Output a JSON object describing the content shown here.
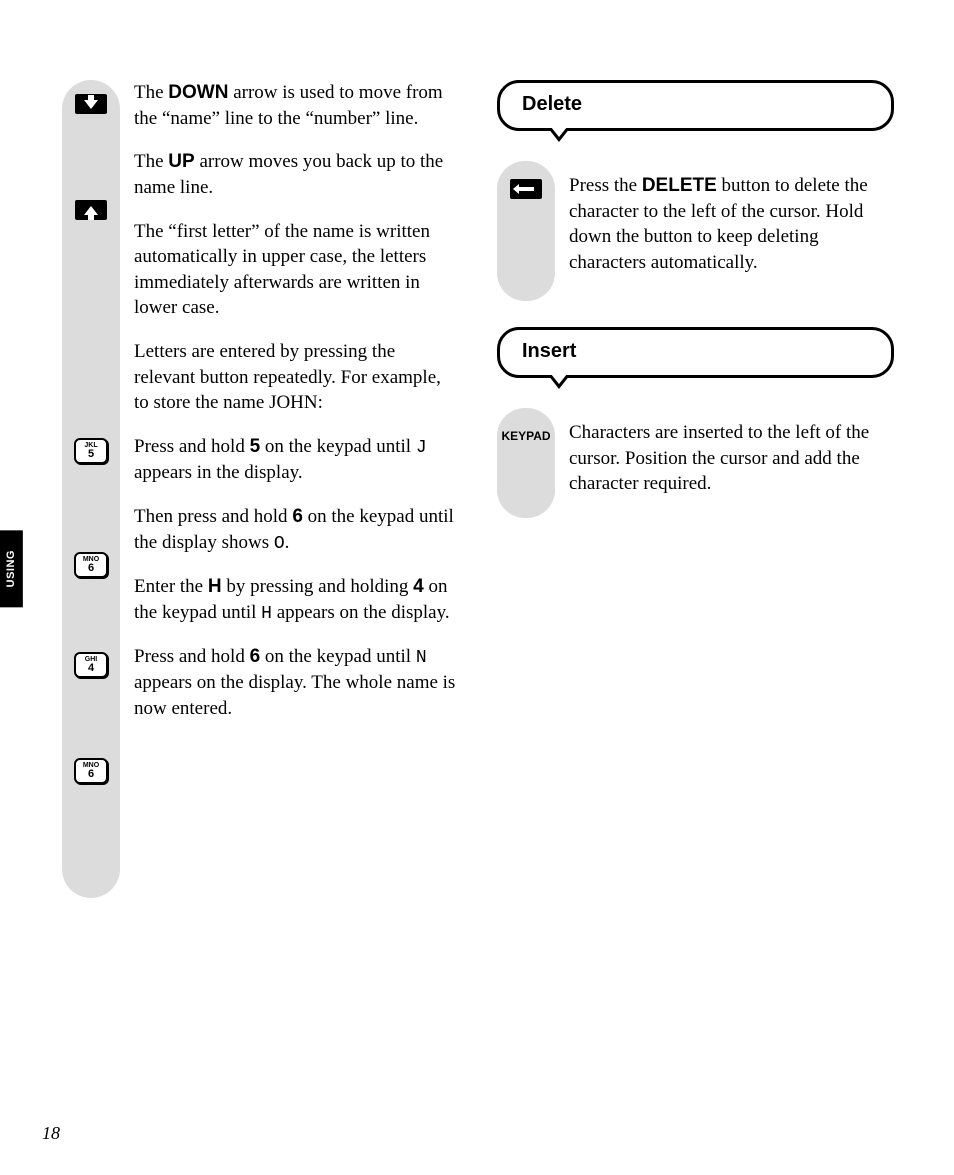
{
  "sideTab": "USING",
  "pageNumber": "18",
  "left": {
    "icons": {
      "down": "arrow-down",
      "up": "arrow-up",
      "key5": {
        "letters": "JKL",
        "num": "5"
      },
      "key6a": {
        "letters": "MNO",
        "num": "6"
      },
      "key4": {
        "letters": "GHI",
        "num": "4"
      },
      "key6b": {
        "letters": "MNO",
        "num": "6"
      }
    },
    "p1a": "The ",
    "p1b": "DOWN",
    "p1c": " arrow is used to move from the “name” line to the “number” line.",
    "p2a": "The ",
    "p2b": "UP",
    "p2c": " arrow moves you back up to the name line.",
    "p3": "The “first letter” of the name is written automatically in upper case, the letters immediately afterwards are written in lower case.",
    "p4": "Letters are entered by pressing the relevant button repeatedly. For example, to store the name JOHN:",
    "p5a": "Press and hold ",
    "p5b": "5",
    "p5c": " on the keypad until ",
    "p5d": "J",
    "p5e": " appears in the display.",
    "p6a": "Then press and hold ",
    "p6b": "6",
    "p6c": " on the keypad until the display shows ",
    "p6d": "O",
    "p6e": ".",
    "p7a": "Enter the ",
    "p7b": "H",
    "p7c": " by pressing and holding ",
    "p7d": "4",
    "p7e": " on the keypad until ",
    "p7f": "H",
    "p7g": " appears on the display.",
    "p8a": "Press and hold ",
    "p8b": "6",
    "p8c": " on the keypad until ",
    "p8d": "N",
    "p8e": " appears on the display. The whole name is now entered."
  },
  "right": {
    "deleteHead": "Delete",
    "delA": "Press the ",
    "delB": "DELETE",
    "delC": " button to delete the character to the left of the cursor. Hold down the button to keep deleting characters automatically.",
    "insertHead": "Insert",
    "keypadLabel": "KEYPAD",
    "insertBody": "Characters are inserted to the left of the cursor. Position the cursor and add the character required."
  }
}
